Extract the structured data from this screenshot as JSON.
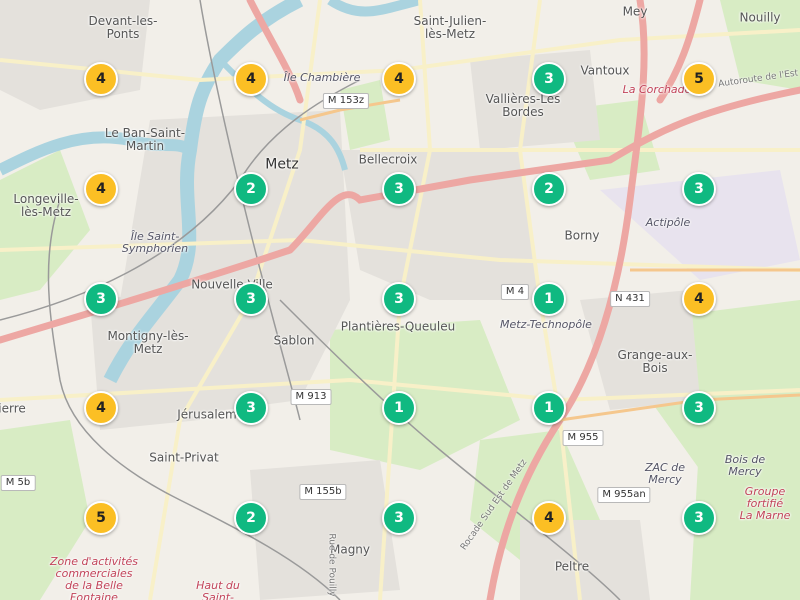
{
  "map": {
    "colors": {
      "land": "#f2efe9",
      "water": "#aad3df",
      "park": "#d8ecc4",
      "urban": "#e4e1dc",
      "major_road": "#eda7a3",
      "minor_road": "#f8f0c8",
      "cluster_green": "#10b981",
      "cluster_yellow": "#fbbf24"
    },
    "places": [
      {
        "name": "Devant-les-\nPonts",
        "style": "normal"
      },
      {
        "name": "Saint-Julien-\nlès-Metz",
        "style": "normal"
      },
      {
        "name": "Mey",
        "style": "normal"
      },
      {
        "name": "Nouilly",
        "style": "normal"
      },
      {
        "name": "Île Chambière",
        "style": "ital"
      },
      {
        "name": "Vantoux",
        "style": "normal"
      },
      {
        "name": "Vallières-Les\nBordes",
        "style": "normal"
      },
      {
        "name": "La Corchade",
        "style": "red"
      },
      {
        "name": "Le Ban-Saint-\nMartin",
        "style": "normal"
      },
      {
        "name": "Metz",
        "style": "big"
      },
      {
        "name": "Bellecroix",
        "style": "normal"
      },
      {
        "name": "Longeville-\nlès-Metz",
        "style": "normal"
      },
      {
        "name": "Île Saint-\nSymphorien",
        "style": "ital"
      },
      {
        "name": "Borny",
        "style": "normal"
      },
      {
        "name": "Actipôle",
        "style": "ital"
      },
      {
        "name": "Nouvelle Ville",
        "style": "normal"
      },
      {
        "name": "Montigny-lès-\nMetz",
        "style": "normal"
      },
      {
        "name": "Sablon",
        "style": "normal"
      },
      {
        "name": "Plantières-Queuleu",
        "style": "normal"
      },
      {
        "name": "Metz-Technopôle",
        "style": "ital"
      },
      {
        "name": "Grange-aux-\nBois",
        "style": "normal"
      },
      {
        "name": "Jérusalem",
        "style": "normal"
      },
      {
        "name": "Saint-Privat",
        "style": "normal"
      },
      {
        "name": "Bois de\nMercy",
        "style": "ital"
      },
      {
        "name": "ZAC de\nMercy",
        "style": "ital"
      },
      {
        "name": "Groupe\nfortifié\nLa Marne",
        "style": "red"
      },
      {
        "name": "Zone d'activités\ncommerciales\nde la Belle\nFontaine",
        "style": "red"
      },
      {
        "name": "Magny",
        "style": "normal"
      },
      {
        "name": "Peltre",
        "style": "normal"
      },
      {
        "name": "Haut du\nSaint-",
        "style": "red"
      },
      {
        "name": "ierre",
        "style": "normal"
      },
      {
        "name": "Actipôle",
        "style": "ital"
      }
    ],
    "road_shields": [
      "M 153z",
      "M 4",
      "N 431",
      "M 913",
      "M 955",
      "M 155b",
      "M 955an",
      "M 5b"
    ],
    "road_names": [
      "Autoroute de l'Est",
      "Rocade Sud Est de Metz",
      "Rue de Pouilly"
    ],
    "clusters": [
      {
        "count": "4",
        "color": "yellow"
      },
      {
        "count": "4",
        "color": "yellow"
      },
      {
        "count": "4",
        "color": "yellow"
      },
      {
        "count": "3",
        "color": "green"
      },
      {
        "count": "5",
        "color": "yellow"
      },
      {
        "count": "4",
        "color": "yellow"
      },
      {
        "count": "2",
        "color": "green"
      },
      {
        "count": "3",
        "color": "green"
      },
      {
        "count": "2",
        "color": "green"
      },
      {
        "count": "3",
        "color": "green"
      },
      {
        "count": "3",
        "color": "green"
      },
      {
        "count": "3",
        "color": "green"
      },
      {
        "count": "3",
        "color": "green"
      },
      {
        "count": "1",
        "color": "green"
      },
      {
        "count": "4",
        "color": "yellow"
      },
      {
        "count": "4",
        "color": "yellow"
      },
      {
        "count": "3",
        "color": "green"
      },
      {
        "count": "1",
        "color": "green"
      },
      {
        "count": "1",
        "color": "green"
      },
      {
        "count": "3",
        "color": "green"
      },
      {
        "count": "5",
        "color": "yellow"
      },
      {
        "count": "2",
        "color": "green"
      },
      {
        "count": "3",
        "color": "green"
      },
      {
        "count": "4",
        "color": "yellow"
      },
      {
        "count": "3",
        "color": "green"
      }
    ]
  }
}
